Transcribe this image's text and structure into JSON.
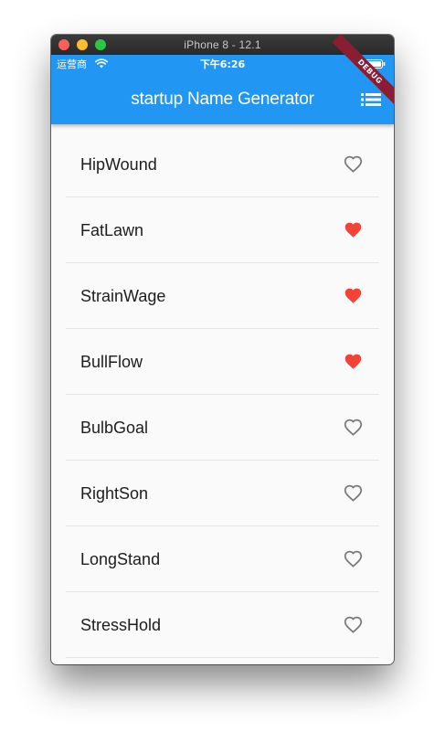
{
  "window": {
    "title": "iPhone 8 - 12.1"
  },
  "status_bar": {
    "carrier": "运营商",
    "time": "下午6:26"
  },
  "app_bar": {
    "title": "startup Name Generator",
    "action_icon": "list-icon",
    "debug_banner": "DEBUG"
  },
  "colors": {
    "primary": "#2196f3",
    "favorite": "#f44336",
    "unfavorite": "#7a7a7a"
  },
  "suggestions": [
    {
      "name": "HipWound",
      "saved": false
    },
    {
      "name": "FatLawn",
      "saved": true
    },
    {
      "name": "StrainWage",
      "saved": true
    },
    {
      "name": "BullFlow",
      "saved": true
    },
    {
      "name": "BulbGoal",
      "saved": false
    },
    {
      "name": "RightSon",
      "saved": false
    },
    {
      "name": "LongStand",
      "saved": false
    },
    {
      "name": "StressHold",
      "saved": false
    }
  ]
}
